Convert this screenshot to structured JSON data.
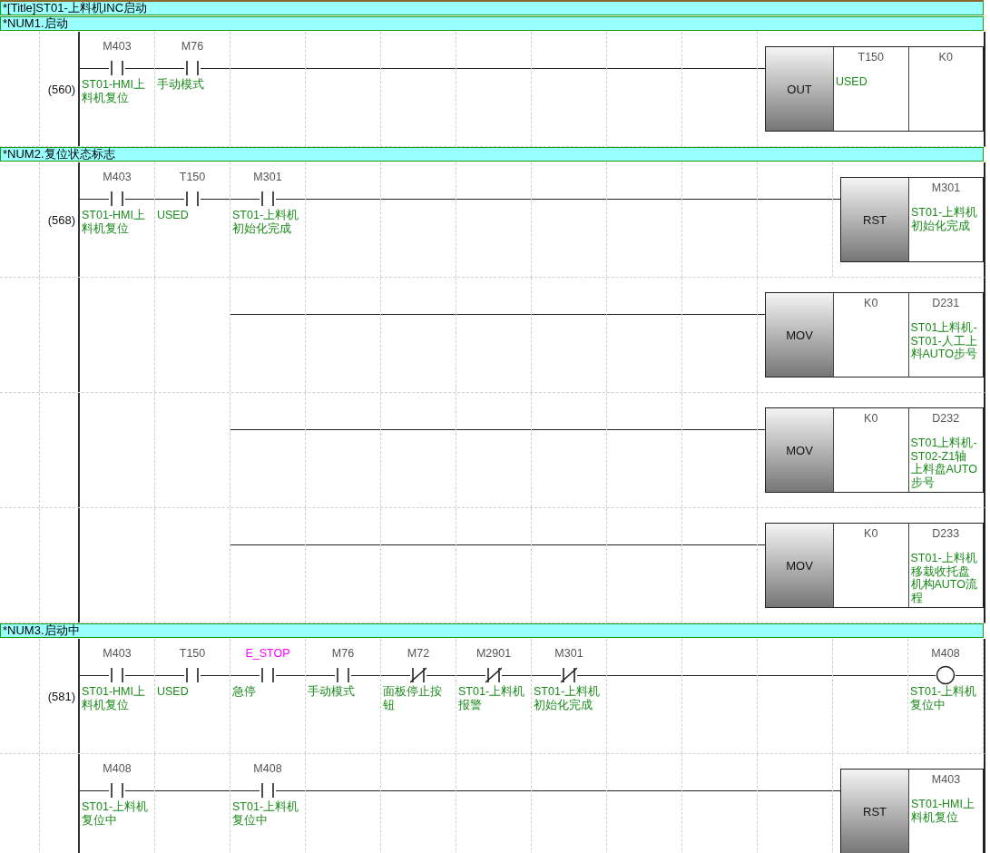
{
  "title": "*[Title]ST01-上料机INC启动",
  "sections": [
    {
      "heading": "*NUM1.启动",
      "rungs": [
        {
          "step": "(560)",
          "cells": [
            {
              "kind": "no",
              "device": "M403",
              "comment": "ST01-HMI上料机复位"
            },
            {
              "kind": "no",
              "device": "M76",
              "comment": "手动模式"
            }
          ],
          "output": {
            "kind": "instruction",
            "op": "OUT",
            "operands": [
              {
                "device": "T150",
                "comment": "USED"
              },
              {
                "device": "K0"
              }
            ]
          }
        }
      ]
    },
    {
      "heading": "*NUM2.复位状态标志",
      "rungs": [
        {
          "step": "(568)",
          "cells": [
            {
              "kind": "no",
              "device": "M403",
              "comment": "ST01-HMI上料机复位"
            },
            {
              "kind": "no",
              "device": "T150",
              "comment": "USED"
            },
            {
              "kind": "no",
              "device": "M301",
              "comment": "ST01-上料机初始化完成"
            }
          ],
          "output": {
            "kind": "instruction",
            "op": "RST",
            "operands": [
              {
                "device": "M301",
                "comment": "ST01-上料机初始化完成"
              }
            ]
          }
        },
        {
          "cells": [
            {
              "kind": "gap"
            },
            {
              "kind": "gap"
            }
          ],
          "output": {
            "kind": "instruction",
            "op": "MOV",
            "operands": [
              {
                "device": "K0"
              },
              {
                "device": "D231",
                "comment": "ST01上料机-ST01-人工上料AUTO步号"
              }
            ]
          }
        },
        {
          "cells": [
            {
              "kind": "gap"
            },
            {
              "kind": "gap"
            }
          ],
          "output": {
            "kind": "instruction",
            "op": "MOV",
            "operands": [
              {
                "device": "K0"
              },
              {
                "device": "D232",
                "comment": "ST01上料机-ST02-Z1轴上料盘AUTO步号"
              }
            ]
          }
        },
        {
          "cells": [
            {
              "kind": "gap"
            },
            {
              "kind": "gap"
            }
          ],
          "output": {
            "kind": "instruction",
            "op": "MOV",
            "operands": [
              {
                "device": "K0"
              },
              {
                "device": "D233",
                "comment": "ST01-上料机移栽收托盘机构AUTO流程"
              }
            ]
          }
        }
      ]
    },
    {
      "heading": "*NUM3.启动中",
      "rungs": [
        {
          "step": "(581)",
          "cells": [
            {
              "kind": "no",
              "device": "M403",
              "comment": "ST01-HMI上料机复位"
            },
            {
              "kind": "no",
              "device": "T150",
              "comment": "USED"
            },
            {
              "kind": "no",
              "device": "E_STOP",
              "comment": "急停",
              "label": true
            },
            {
              "kind": "no",
              "device": "M76",
              "comment": "手动模式"
            },
            {
              "kind": "nc",
              "device": "M72",
              "comment": "面板停止按钮"
            },
            {
              "kind": "nc",
              "device": "M2901",
              "comment": "ST01-上料机报警"
            },
            {
              "kind": "nc",
              "device": "M301",
              "comment": "ST01-上料机初始化完成"
            }
          ],
          "output": {
            "kind": "coil",
            "device": "M408",
            "comment": "ST01-上料机复位中"
          }
        },
        {
          "cells": [
            {
              "kind": "no",
              "device": "M408",
              "comment": "ST01-上料机复位中"
            },
            {
              "kind": "wire"
            },
            {
              "kind": "no",
              "device": "M408",
              "comment": "ST01-上料机复位中"
            }
          ],
          "output": {
            "kind": "instruction",
            "op": "RST",
            "operands": [
              {
                "device": "M403",
                "comment": "ST01-HMI上料机复位"
              }
            ]
          }
        }
      ]
    }
  ]
}
